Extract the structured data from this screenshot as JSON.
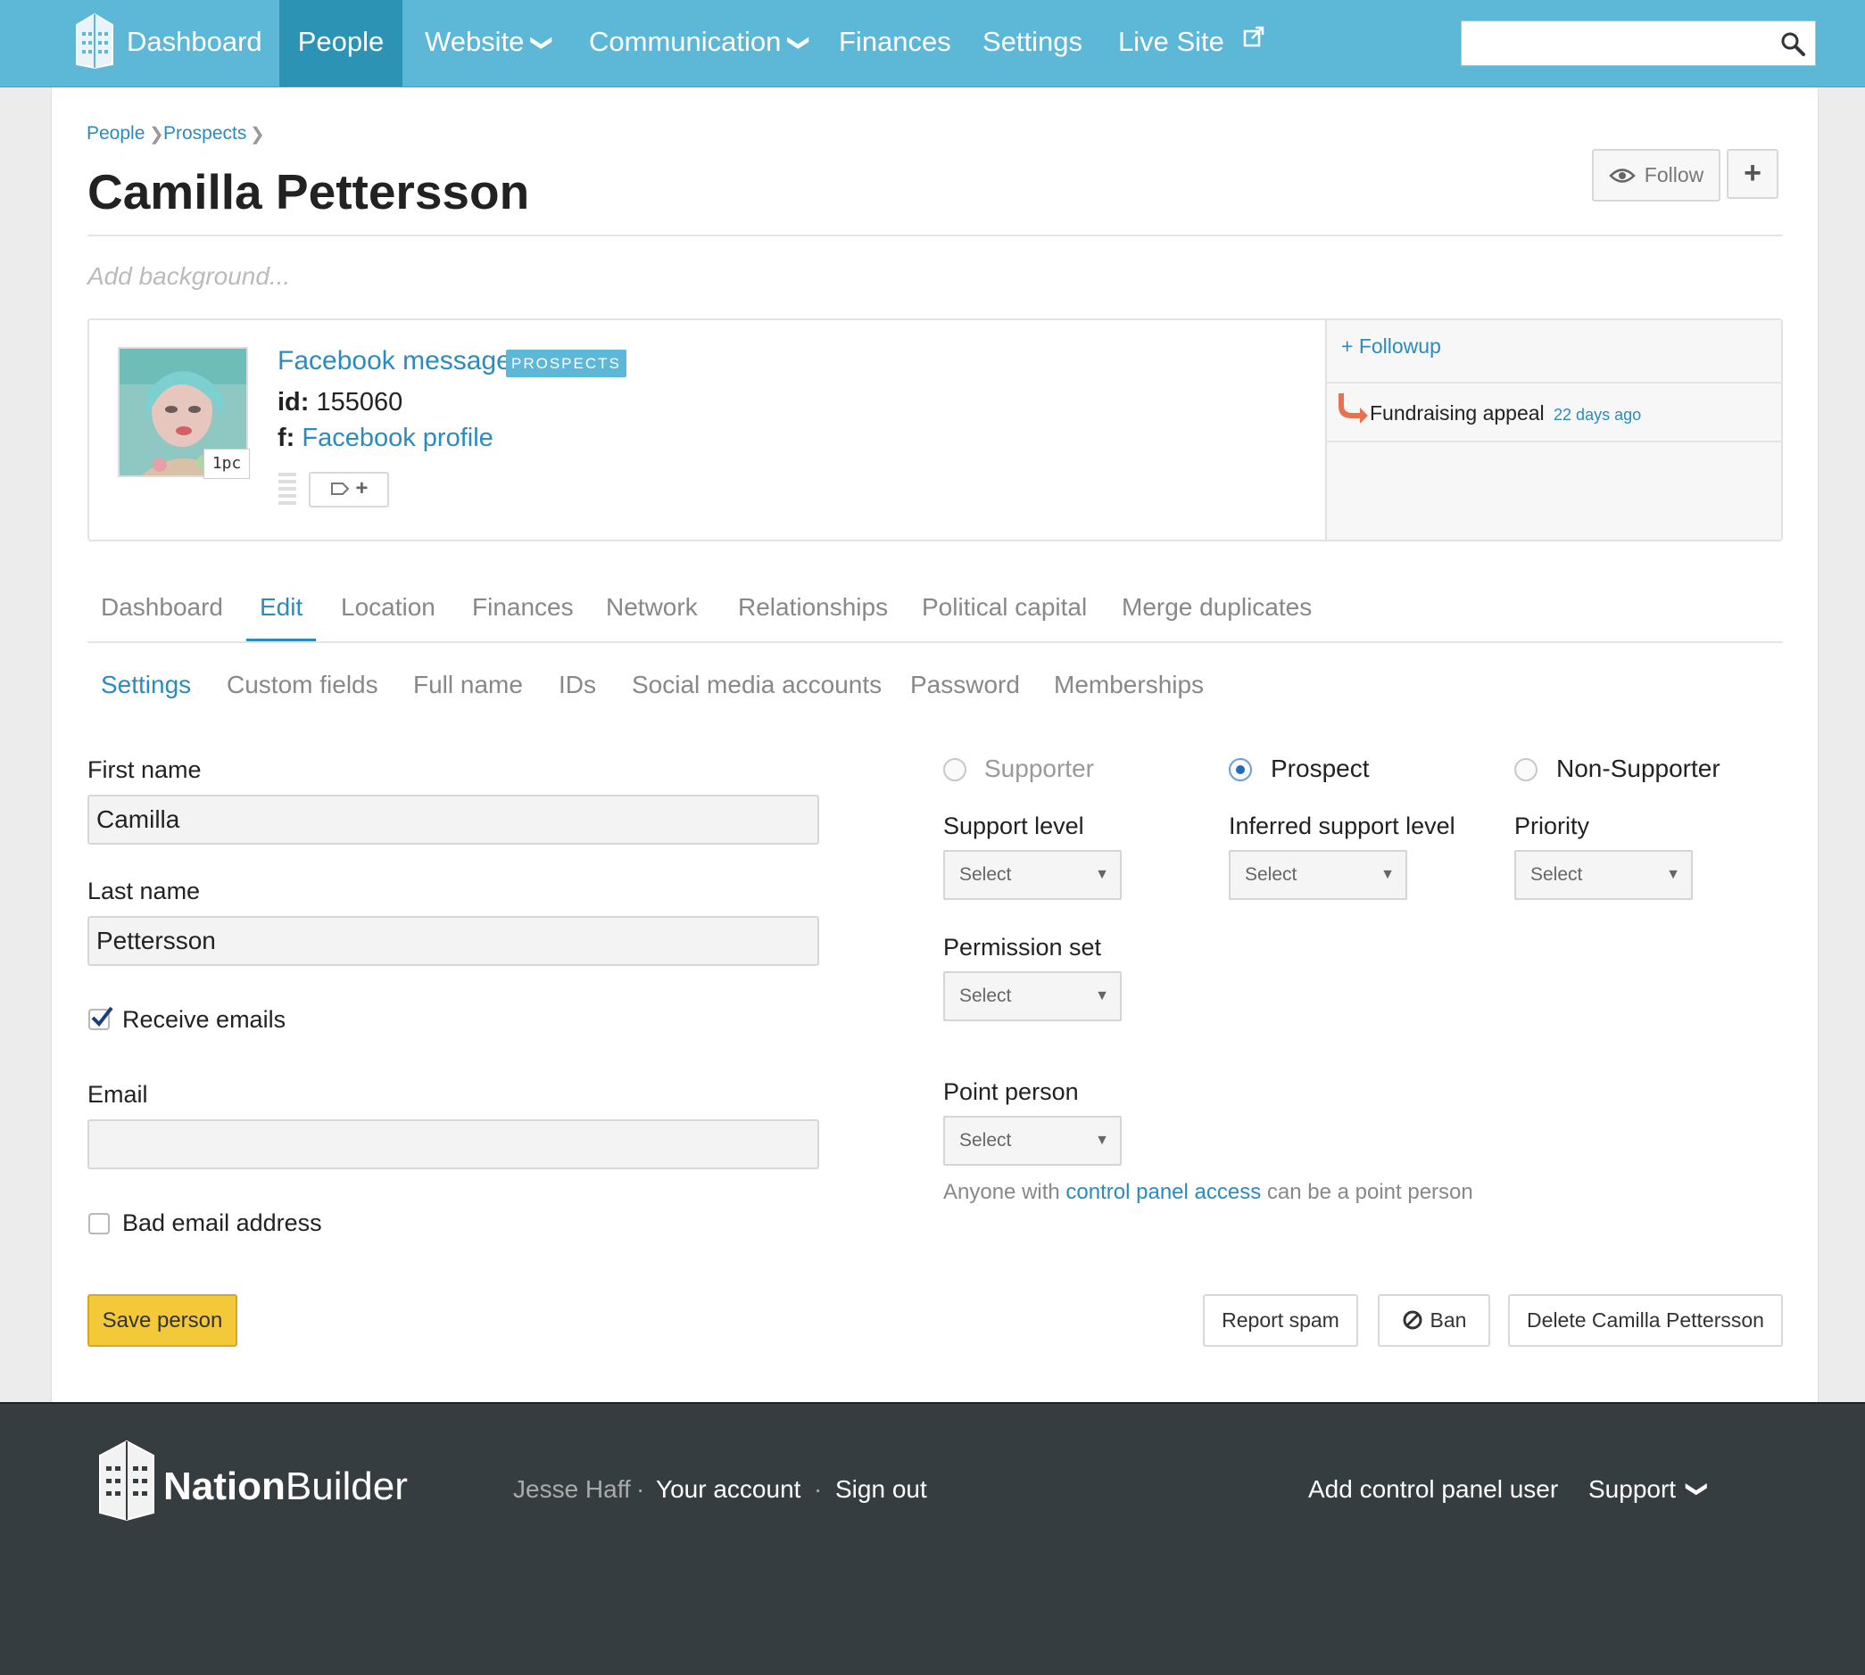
{
  "nav": {
    "items": [
      {
        "label": "Dashboard"
      },
      {
        "label": "People"
      },
      {
        "label": "Website"
      },
      {
        "label": "Communication"
      },
      {
        "label": "Finances"
      },
      {
        "label": "Settings"
      },
      {
        "label": "Live Site"
      }
    ],
    "search_placeholder": ""
  },
  "breadcrumb": [
    "People",
    "Prospects"
  ],
  "person": {
    "name": "Camilla Pettersson",
    "background_placeholder": "Add background...",
    "source": "Facebook message",
    "tag": "PROSPECTS",
    "id_label": "id:",
    "id": "155060",
    "fb_label": "f:",
    "fb_link": "Facebook profile",
    "avatar_badge": "1pc"
  },
  "actions": {
    "follow": "Follow"
  },
  "followup": {
    "add": "+ Followup",
    "item_title": "Fundraising appeal",
    "item_time": "22 days ago"
  },
  "tabs": [
    "Dashboard",
    "Edit",
    "Location",
    "Finances",
    "Network",
    "Relationships",
    "Political capital",
    "Merge duplicates"
  ],
  "subtabs": [
    "Settings",
    "Custom fields",
    "Full name",
    "IDs",
    "Social media accounts",
    "Password",
    "Memberships"
  ],
  "form": {
    "first_name_label": "First name",
    "first_name": "Camilla",
    "last_name_label": "Last name",
    "last_name": "Pettersson",
    "receive_emails": "Receive emails",
    "email_label": "Email",
    "email": "",
    "bad_email": "Bad email address",
    "status_options": [
      "Supporter",
      "Prospect",
      "Non-Supporter"
    ],
    "status_selected": "Prospect",
    "support_level_label": "Support level",
    "inferred_label": "Inferred support level",
    "priority_label": "Priority",
    "permission_label": "Permission set",
    "point_person_label": "Point person",
    "select_placeholder": "Select",
    "point_note_before": "Anyone with",
    "point_note_link": "control panel access",
    "point_note_after": "can be a point person"
  },
  "buttons": {
    "save": "Save person",
    "report_spam": "Report spam",
    "ban": "Ban",
    "delete": "Delete Camilla Pettersson"
  },
  "footer": {
    "brand_a": "Nation",
    "brand_b": "Builder",
    "user": "Jesse Haff",
    "your_account": "Your account",
    "sign_out": "Sign out",
    "add_user": "Add control panel user",
    "support": "Support"
  }
}
